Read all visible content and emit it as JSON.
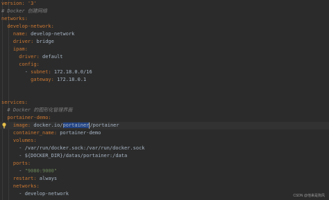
{
  "editor": {
    "lines": [
      {
        "segments": [
          {
            "t": "version: '3'",
            "c": "k"
          }
        ]
      },
      {
        "segments": [
          {
            "t": "# Docker 创建网络",
            "c": "c"
          }
        ]
      },
      {
        "segments": [
          {
            "t": "networks:",
            "c": "k"
          }
        ]
      },
      {
        "segments": [
          {
            "t": "  develop-network:",
            "c": "k"
          }
        ]
      },
      {
        "segments": [
          {
            "t": "    name: ",
            "c": "k"
          },
          {
            "t": "develop-network",
            "c": "v"
          }
        ]
      },
      {
        "segments": [
          {
            "t": "    driver: ",
            "c": "k"
          },
          {
            "t": "bridge",
            "c": "v"
          }
        ]
      },
      {
        "segments": [
          {
            "t": "    ipam:",
            "c": "k"
          }
        ]
      },
      {
        "segments": [
          {
            "t": "      driver: ",
            "c": "k"
          },
          {
            "t": "default",
            "c": "v"
          }
        ]
      },
      {
        "segments": [
          {
            "t": "      config:",
            "c": "k"
          }
        ]
      },
      {
        "segments": [
          {
            "t": "        - ",
            "c": "v"
          },
          {
            "t": "subnet: ",
            "c": "k"
          },
          {
            "t": "172.18.0.0/16",
            "c": "v"
          }
        ]
      },
      {
        "segments": [
          {
            "t": "          gateway: ",
            "c": "k"
          },
          {
            "t": "172.18.0.1",
            "c": "v"
          }
        ]
      },
      {
        "segments": []
      },
      {
        "segments": []
      },
      {
        "segments": [
          {
            "t": "services:",
            "c": "k"
          }
        ]
      },
      {
        "segments": [
          {
            "t": "  # Docker 的图形化管理界面",
            "c": "c"
          }
        ]
      },
      {
        "segments": [
          {
            "t": "  portainer-demo:",
            "c": "k"
          }
        ]
      },
      {
        "segments": [
          {
            "t": "    image: ",
            "c": "k"
          },
          {
            "t": "docker.io/",
            "c": "v"
          },
          {
            "t": "portainer",
            "c": "sel"
          },
          {
            "t": "/portainer",
            "c": "v"
          }
        ],
        "highlight": true,
        "bulb": true
      },
      {
        "segments": [
          {
            "t": "    container_name: ",
            "c": "k"
          },
          {
            "t": "portainer-demo",
            "c": "v"
          }
        ]
      },
      {
        "segments": [
          {
            "t": "    volumes:",
            "c": "k"
          }
        ]
      },
      {
        "segments": [
          {
            "t": "      - /var/run/docker.sock:/var/run/docker.sock",
            "c": "v"
          }
        ]
      },
      {
        "segments": [
          {
            "t": "      - ${DOCKER_DIR}/datas/portainer:/data",
            "c": "v"
          }
        ]
      },
      {
        "segments": [
          {
            "t": "    ports:",
            "c": "k"
          }
        ]
      },
      {
        "segments": [
          {
            "t": "      - ",
            "c": "v"
          },
          {
            "t": "\"9080:9000\"",
            "c": "s"
          }
        ]
      },
      {
        "segments": [
          {
            "t": "    restart: ",
            "c": "k"
          },
          {
            "t": "always",
            "c": "v"
          }
        ]
      },
      {
        "segments": [
          {
            "t": "    networks:",
            "c": "k"
          }
        ]
      },
      {
        "segments": [
          {
            "t": "      - develop-network",
            "c": "v"
          }
        ]
      }
    ]
  },
  "watermark": "CSDN @他来是狗风",
  "colors": {
    "background": "#2b2b2b",
    "key": "#cc7832",
    "value": "#a9b7c6",
    "string": "#6a8759",
    "comment": "#808080",
    "selection": "#214283",
    "current_line": "#323232"
  },
  "icons": {
    "bulb": "lightbulb-icon"
  }
}
